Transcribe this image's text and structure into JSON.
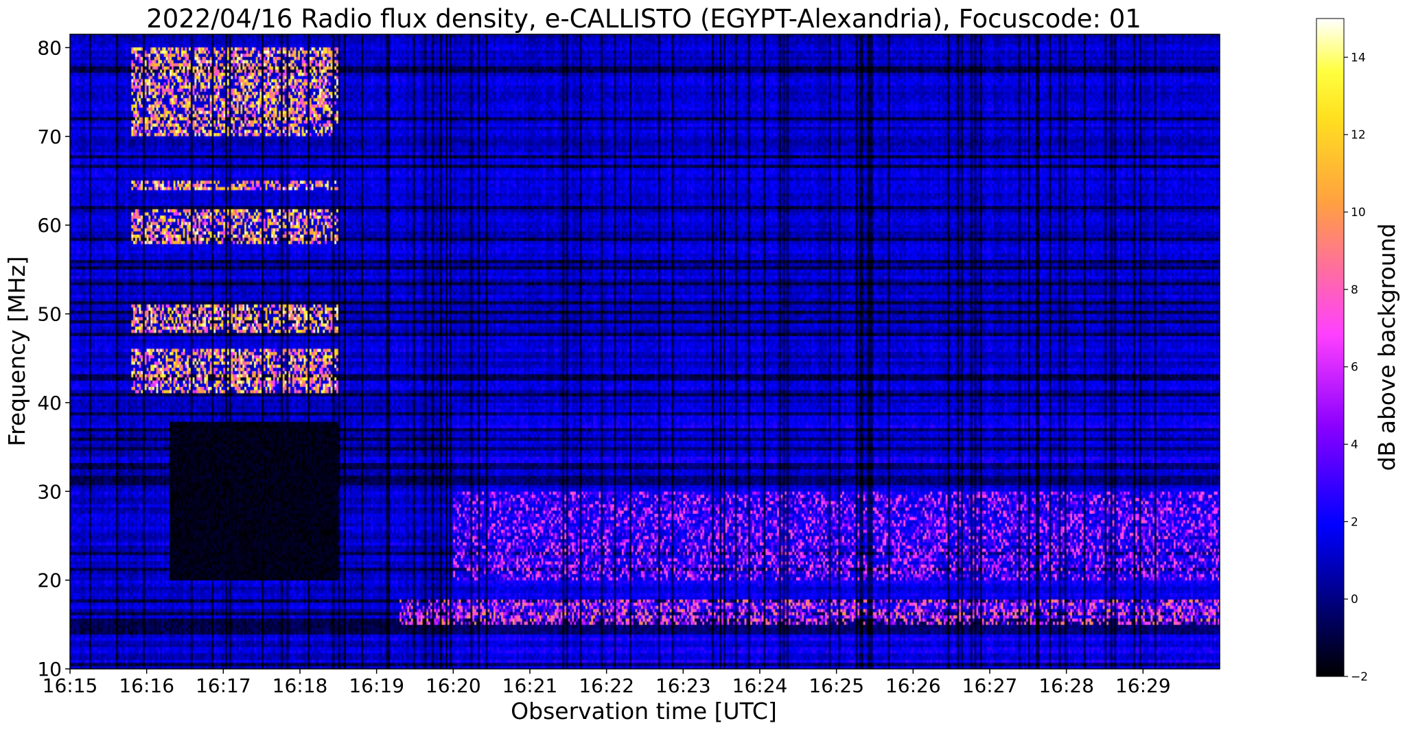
{
  "chart_data": {
    "type": "heatmap",
    "title": "2022/04/16  Radio flux density, e-CALLISTO (EGYPT-Alexandria), Focuscode: 01",
    "xlabel": "Observation time [UTC]",
    "ylabel": "Frequency [MHz]",
    "x_ticks": [
      "16:15",
      "16:16",
      "16:17",
      "16:18",
      "16:19",
      "16:20",
      "16:21",
      "16:22",
      "16:23",
      "16:24",
      "16:25",
      "16:26",
      "16:27",
      "16:28",
      "16:29"
    ],
    "xlim": [
      "16:15",
      "16:30"
    ],
    "y_ticks": [
      10,
      20,
      30,
      40,
      50,
      60,
      70,
      80
    ],
    "ylim": [
      10,
      81.5
    ],
    "colorbar": {
      "label": "dB above background",
      "ticks": [
        -2,
        0,
        2,
        4,
        6,
        8,
        10,
        12,
        14
      ],
      "range": [
        -2,
        15
      ],
      "colormap": [
        "#000000",
        "#00007a",
        "#0000ff",
        "#8a00ff",
        "#ff40ff",
        "#ff6e9e",
        "#ffa040",
        "#ffe020",
        "#ffff40",
        "#ffffff"
      ]
    },
    "grid": false,
    "features": [
      {
        "time_start": "16:15.8",
        "time_end": "16:18.5",
        "freq_bands_mhz": [
          [
            70,
            80
          ],
          [
            41,
            46
          ],
          [
            48,
            51
          ],
          [
            58,
            62
          ],
          [
            64,
            65
          ]
        ],
        "level_db": [
          6,
          15
        ]
      },
      {
        "time_start": "16:19.3",
        "time_end": "16:30",
        "freq_bands_mhz": [
          [
            15,
            18
          ]
        ],
        "level_db": [
          3,
          10
        ]
      },
      {
        "time_start": "16:20",
        "time_end": "16:30",
        "freq_bands_mhz": [
          [
            20,
            30
          ]
        ],
        "level_db": [
          1,
          8
        ]
      },
      {
        "time_start": "16:16.3",
        "time_end": "16:18.5",
        "freq_bands_mhz": [
          [
            20,
            38
          ]
        ],
        "level_db": [
          -2,
          -1
        ]
      }
    ]
  }
}
